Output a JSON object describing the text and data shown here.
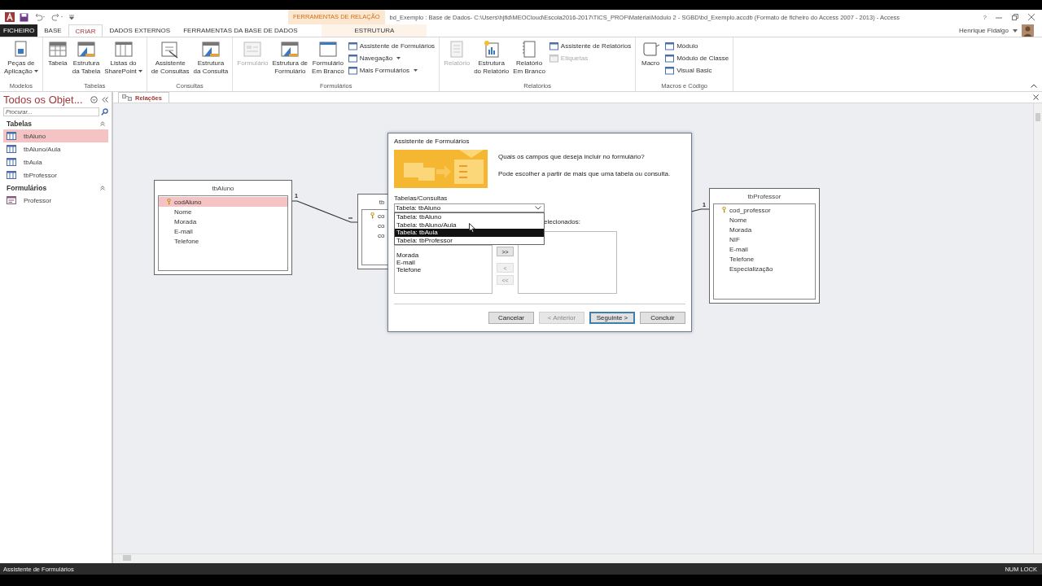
{
  "title_bar": {
    "context_header": "FERRAMENTAS DE RELAÇÃO",
    "title": "bd_Exemplo : Base de Dados- C:\\Users\\hjfid\\MEOCloud\\Escola2016-2017\\TICS_PROF\\Matéria\\Módulo 2 - SGBD\\bd_Exemplo.accdb (Formato de ficheiro do Access 2007 - 2013) - Access",
    "help": "?",
    "user": "Henrique Fidalgo"
  },
  "tabs": [
    {
      "label": "FICHEIRO",
      "kind": "file",
      "selected": false
    },
    {
      "label": "BASE",
      "kind": "tab",
      "selected": false
    },
    {
      "label": "CRIAR",
      "kind": "tab",
      "selected": true
    },
    {
      "label": "DADOS EXTERNOS",
      "kind": "tab",
      "selected": false
    },
    {
      "label": "FERRAMENTAS DA BASE DE DADOS",
      "kind": "tab",
      "selected": false
    },
    {
      "label": "ESTRUTURA",
      "kind": "context",
      "selected": false
    }
  ],
  "ribbon_groups": [
    {
      "label": "Modelos",
      "large": [
        {
          "label": "Peças de\nAplicação",
          "kind": "parts",
          "menu": true,
          "disabled": false
        }
      ]
    },
    {
      "label": "Tabelas",
      "large": [
        {
          "label": "Tabela",
          "kind": "table",
          "menu": false,
          "disabled": false
        },
        {
          "label": "Estrutura\nda Tabela",
          "kind": "design",
          "menu": false,
          "disabled": false
        },
        {
          "label": "Listas do\nSharePoint",
          "kind": "list",
          "menu": true,
          "disabled": false
        }
      ]
    },
    {
      "label": "Consultas",
      "large": [
        {
          "label": "Assistente\nde Consultas",
          "kind": "wizard",
          "menu": false,
          "disabled": false
        },
        {
          "label": "Estrutura\nda Consulta",
          "kind": "design",
          "menu": false,
          "disabled": false
        }
      ]
    },
    {
      "label": "Formulários",
      "large": [
        {
          "label": "Formulário",
          "kind": "form",
          "menu": false,
          "disabled": true
        },
        {
          "label": "Estrutura de\nFormulário",
          "kind": "design",
          "menu": false,
          "disabled": false
        },
        {
          "label": "Formulário\nEm Branco",
          "kind": "blank",
          "menu": false,
          "disabled": false
        }
      ],
      "small": [
        {
          "label": "Assistente de Formulários",
          "menu": false,
          "disabled": false
        },
        {
          "label": "Navegação",
          "menu": true,
          "disabled": false
        },
        {
          "label": "Mais Formulários",
          "menu": true,
          "disabled": false
        }
      ]
    },
    {
      "label": "Relatórios",
      "large": [
        {
          "label": "Relatório",
          "kind": "report",
          "menu": false,
          "disabled": true
        },
        {
          "label": "Estrutura\ndo Relatório",
          "kind": "chart",
          "menu": false,
          "disabled": false
        },
        {
          "label": "Relatório\nEm Branco",
          "kind": "page",
          "menu": false,
          "disabled": false
        }
      ],
      "small": [
        {
          "label": "Assistente de Relatórios",
          "menu": false,
          "disabled": false
        },
        {
          "label": "Etiquetas",
          "menu": false,
          "disabled": true
        }
      ]
    },
    {
      "label": "Macros e Código",
      "large": [
        {
          "label": "Macro",
          "kind": "scroll",
          "menu": false,
          "disabled": false
        }
      ],
      "small": [
        {
          "label": "Módulo",
          "menu": false,
          "disabled": false
        },
        {
          "label": "Módulo de Classe",
          "menu": false,
          "disabled": false
        },
        {
          "label": "Visual Basic",
          "menu": false,
          "disabled": false
        }
      ]
    }
  ],
  "nav_pane": {
    "title": "Todos os Objet...",
    "search": {
      "placeholder": "Procurar..."
    },
    "groups": [
      {
        "label": "Tabelas",
        "items": [
          {
            "label": "tbAluno",
            "kind": "table",
            "selected": true
          },
          {
            "label": "tbAluno/Aula",
            "kind": "table",
            "selected": false
          },
          {
            "label": "tbAula",
            "kind": "table",
            "selected": false
          },
          {
            "label": "tbProfessor",
            "kind": "table",
            "selected": false
          }
        ]
      },
      {
        "label": "Formulários",
        "items": [
          {
            "label": "Professor",
            "kind": "form",
            "selected": false
          }
        ]
      }
    ]
  },
  "document_tab": {
    "label": "Relações"
  },
  "relationship_tables": [
    {
      "title": "tbAluno",
      "fields": [
        {
          "name": "codAluno",
          "key": true,
          "selected": true
        },
        {
          "name": "Nome",
          "key": false,
          "selected": false
        },
        {
          "name": "Morada",
          "key": false,
          "selected": false
        },
        {
          "name": "E-mail",
          "key": false,
          "selected": false
        },
        {
          "name": "Telefone",
          "key": false,
          "selected": false
        }
      ]
    },
    {
      "title": "tb",
      "fields": [
        {
          "name": "co",
          "key": true,
          "selected": false
        },
        {
          "name": "co",
          "key": false,
          "selected": false
        },
        {
          "name": "co",
          "key": false,
          "selected": false
        }
      ]
    },
    {
      "title": "tbProfessor",
      "fields": [
        {
          "name": "cod_professor",
          "key": true,
          "selected": false
        },
        {
          "name": "Nome",
          "key": false,
          "selected": false
        },
        {
          "name": "Morada",
          "key": false,
          "selected": false
        },
        {
          "name": "NIF",
          "key": false,
          "selected": false
        },
        {
          "name": "E-mail",
          "key": false,
          "selected": false
        },
        {
          "name": "Telefone",
          "key": false,
          "selected": false
        },
        {
          "name": "Especialização",
          "key": false,
          "selected": false
        }
      ]
    }
  ],
  "relationships": [
    {
      "one": "1",
      "many": "∞"
    },
    {
      "one": "1"
    }
  ],
  "dialog": {
    "title": "Assistente de Formulários",
    "question": "Quais os campos que deseja incluir no formulário?",
    "note": "Pode escolher a partir de mais que uma tabela ou consulta.",
    "combo_label": "Tabelas/Consultas",
    "combo_value": "Tabela: tbAluno",
    "combo_options": [
      {
        "label": "Tabela: tbAluno",
        "selected": false
      },
      {
        "label": "Tabela: tbAluno/Aula",
        "selected": false
      },
      {
        "label": "Tabela: tbAula",
        "selected": true
      },
      {
        "label": "Tabela: tbProfessor",
        "selected": false
      }
    ],
    "selected_label": "elecionados:",
    "available_fields": [
      "Morada",
      "E-mail",
      "Telefone"
    ],
    "move_buttons": [
      {
        "label": ">>",
        "disabled": false
      },
      {
        "label": "<",
        "disabled": true
      },
      {
        "label": "<<",
        "disabled": true
      }
    ],
    "buttons": [
      {
        "label": "Cancelar",
        "disabled": false,
        "default": false
      },
      {
        "label": "< Anterior",
        "disabled": true,
        "default": false
      },
      {
        "label": "Seguinte >",
        "disabled": false,
        "default": true
      },
      {
        "label": "Concluir",
        "disabled": false,
        "default": false
      }
    ]
  },
  "status_bar": {
    "left": "Assistente de Formulários",
    "right": "NUM LOCK"
  }
}
